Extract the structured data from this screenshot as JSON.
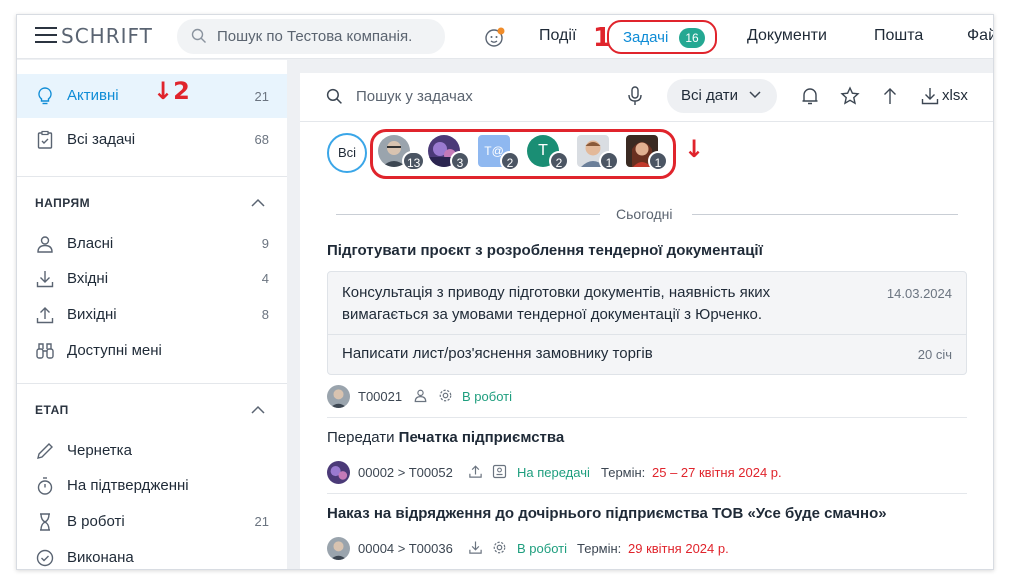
{
  "header": {
    "logo": "SCHRIFT",
    "search_placeholder": "Пошук по Тестова компанія.",
    "nav": [
      "Події",
      "Документи",
      "Пошта",
      "Фай"
    ],
    "tasks_tab": {
      "label": "Задачі",
      "count": "16"
    },
    "marker1": "1"
  },
  "sidebar": {
    "active": {
      "label": "Активні",
      "count": "21"
    },
    "all": {
      "label": "Всі задачі",
      "count": "68"
    },
    "marker2": "2",
    "direction_title": "НАПРЯМ",
    "direction_items": [
      {
        "label": "Власні",
        "count": "9"
      },
      {
        "label": "Вхідні",
        "count": "4"
      },
      {
        "label": "Вихідні",
        "count": "8"
      },
      {
        "label": "Доступні мені",
        "count": ""
      }
    ],
    "stage_title": "ЕТАП",
    "stage_items": [
      {
        "label": "Чернетка",
        "count": ""
      },
      {
        "label": "На підтвердженні",
        "count": ""
      },
      {
        "label": "В роботі",
        "count": "21"
      },
      {
        "label": "Виконана",
        "count": ""
      }
    ]
  },
  "main": {
    "search_placeholder": "Пошук у задачах",
    "dates_label": "Всі дати",
    "export_label": "xlsx",
    "all_button": "Всі",
    "avatars": [
      {
        "count": "13",
        "kind": "photo-man-glasses"
      },
      {
        "count": "3",
        "kind": "photo-purple"
      },
      {
        "count": "2",
        "kind": "initials",
        "initials": "T@"
      },
      {
        "count": "2",
        "kind": "letter",
        "initials": "T"
      },
      {
        "count": "1",
        "kind": "photo-man-young"
      },
      {
        "count": "1",
        "kind": "photo-woman"
      }
    ],
    "day_label": "Сьогодні",
    "tasks": [
      {
        "title": "Підготувати проєкт з розроблення тендерної документації",
        "subtasks": [
          {
            "text": "Консультація з приводу підготовки документів, наявність яких вимагається за умовами тендерної документації з Юрченко.",
            "date": "14.03.2024"
          },
          {
            "text": "Написати лист/роз'яснення замовнику торгів",
            "date": "20 січ"
          }
        ],
        "code": "T00021",
        "status": "В роботі"
      },
      {
        "title_prefix": "Передати ",
        "title_bold": "Печатка підприємства",
        "code": "00002 > T00052",
        "status": "На передачі",
        "term_label": "Термін:",
        "term": "25 – 27 квітня 2024 р."
      },
      {
        "title": "Наказ на відрядження до дочірнього підприємства ТОВ «Усе буде смачно»",
        "code": "00004 > T00036",
        "status": "В роботі",
        "term_label": "Термін:",
        "term": "29 квітня 2024 р."
      }
    ]
  },
  "colors": {
    "accent": "#0f8cd6",
    "badge": "#24a892",
    "annotation": "#e0242c",
    "status_green": "#1e9e7e"
  }
}
